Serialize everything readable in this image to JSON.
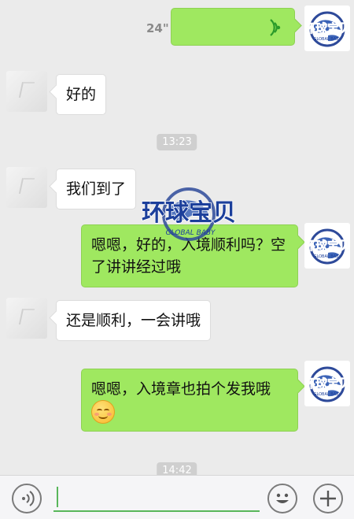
{
  "messages": {
    "voice": {
      "duration": "24\""
    },
    "m1": {
      "text": "好的"
    },
    "m2": {
      "text": "我们到了"
    },
    "m3": {
      "text": "嗯嗯，好的，入境顺利吗？空了讲讲经过哦"
    },
    "m4": {
      "text": "还是顺利，一会讲哦"
    },
    "m5": {
      "text": "嗯嗯，入境章也拍个发我哦",
      "emoji": "smiling-blush-emoji"
    }
  },
  "timestamps": [
    "13:23",
    "14:42"
  ],
  "logo": {
    "line1": "环球宝贝",
    "line2": "GLOBAL BABY"
  },
  "watermark": {
    "line1": "环球宝贝",
    "line2": "GLOBAL BABY"
  },
  "input_bar": {
    "voice_icon": "voice-mode-icon",
    "emoji_icon": "emoji-icon",
    "plus_icon": "plus-icon",
    "placeholder": ""
  },
  "colors": {
    "bubble_right": "#9fe860",
    "bubble_left": "#ffffff",
    "background": "#ebebeb",
    "accent": "#58b65a"
  }
}
